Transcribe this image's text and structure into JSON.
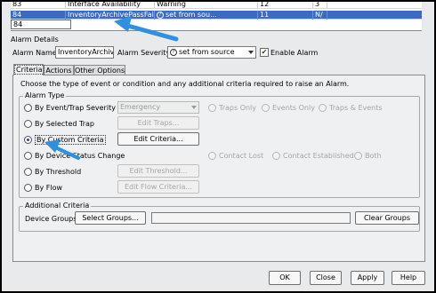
{
  "grid": {
    "rows": [
      {
        "id": "83",
        "name": "Interface Availability",
        "severity": "Warning",
        "count": "12",
        "na": "3"
      },
      {
        "id": "84",
        "name": "InventoryArchivePassFail",
        "severity": "set from sou...",
        "count": "11",
        "na": "N/"
      },
      {
        "id": "84",
        "name": "",
        "severity": "",
        "count": "",
        "na": ""
      }
    ]
  },
  "details": {
    "section_label": "Alarm Details",
    "alarm_name_label": "Alarm Name:",
    "alarm_name_value": "InventoryArchivel",
    "severity_label": "Alarm Severity:",
    "severity_value": "set from source",
    "enable_label": "Enable Alarm",
    "enable_checked": "✔"
  },
  "tabs": [
    "Criteria",
    "Actions",
    "Other Options"
  ],
  "criteria": {
    "description": "Choose the type of event or condition and any additional criteria required to raise an Alarm.",
    "alarm_type_label": "Alarm Type",
    "event_trap": {
      "label": "By Event/Trap Severity",
      "select": "Emergency",
      "opts": [
        "Traps Only",
        "Events Only",
        "Traps & Events"
      ]
    },
    "selected_trap": {
      "label": "By Selected Trap",
      "button": "Edit Traps..."
    },
    "custom": {
      "label": "By Custom Criteria",
      "button": "Edit Criteria..."
    },
    "device_status": {
      "label": "By Device Status Change",
      "opts": [
        "Contact Lost",
        "Contact Established",
        "Both"
      ]
    },
    "threshold": {
      "label": "By Threshold",
      "button": "Edit Threshold..."
    },
    "flow": {
      "label": "By Flow",
      "button": "Edit Flow Criteria..."
    },
    "additional_label": "Additional Criteria",
    "device_groups_label": "Device Groups:",
    "select_groups": "Select Groups...",
    "clear_groups": "Clear Groups"
  },
  "footer": {
    "ok": "OK",
    "close": "Close",
    "apply": "Apply",
    "help": "Help"
  },
  "colors": {
    "selection": "#3d6bc4",
    "annotation_arrow": "#2f8fe0"
  }
}
